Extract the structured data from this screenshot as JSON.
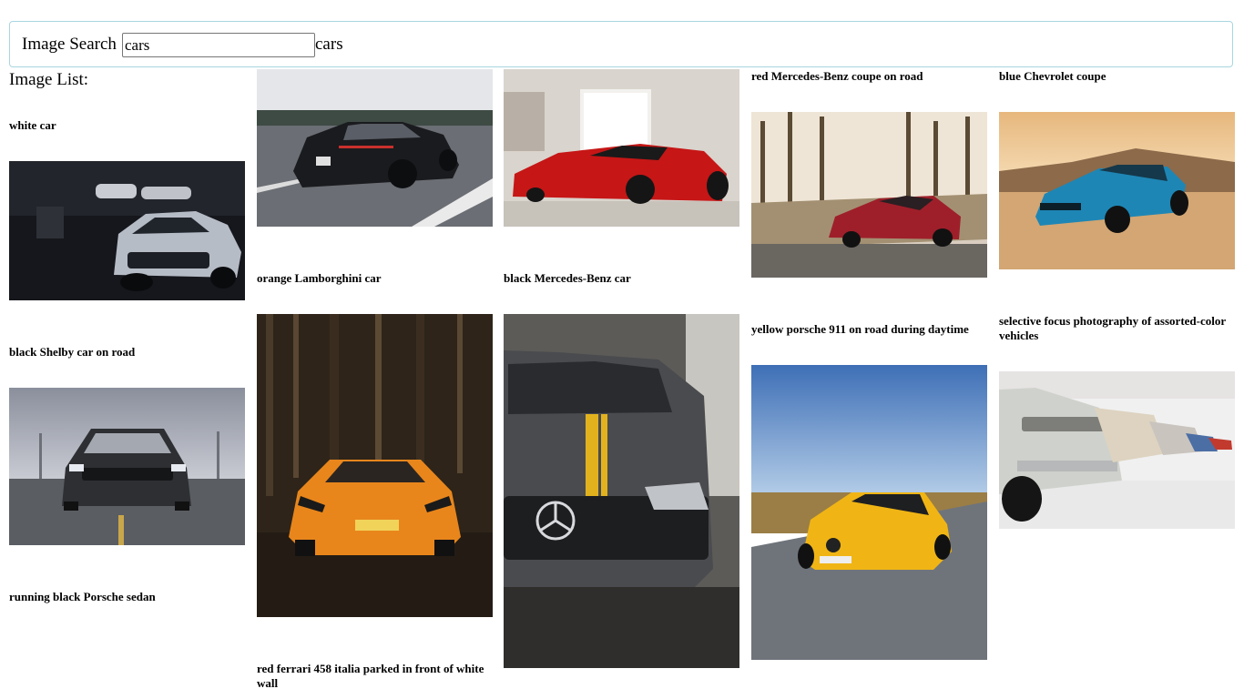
{
  "search": {
    "label": "Image Search",
    "value": "cars",
    "echo": "cars"
  },
  "list": {
    "title": "Image List:"
  },
  "images": [
    {
      "caption": "white car"
    },
    {
      "caption": "black Shelby car on road"
    },
    {
      "caption": "running black Porsche sedan"
    },
    {
      "caption": "orange Lamborghini car"
    },
    {
      "caption": "red ferrari 458 italia parked in front of white wall"
    },
    {
      "caption": "black Mercedes-Benz car"
    },
    {
      "caption": "red Mercedes-Benz coupe on road"
    },
    {
      "caption": "yellow porsche 911 on road during daytime"
    },
    {
      "caption": "blue Chevrolet coupe"
    },
    {
      "caption": "selective focus photography of assorted-color vehicles"
    }
  ],
  "colors": {
    "search_border": "#a9d6e0",
    "page_background": "#ffffff"
  }
}
